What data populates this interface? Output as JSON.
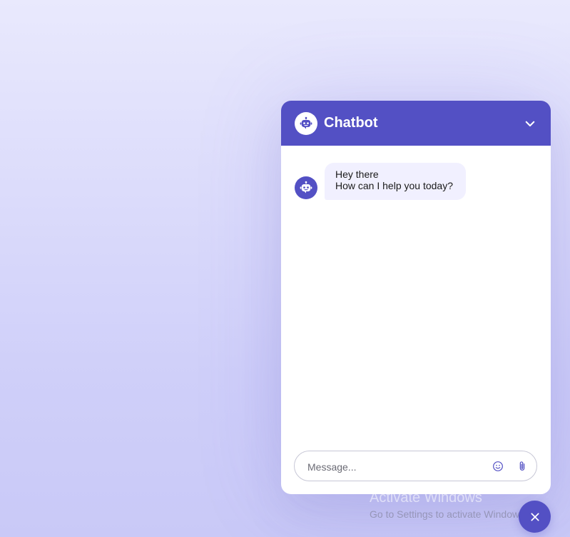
{
  "colors": {
    "primary": "#5350c4",
    "bubble_bg": "#f1f0ff",
    "background_top": "#e9e9fd",
    "background_bottom": "#c9c9f7"
  },
  "header": {
    "title": "Chatbot",
    "avatar_icon": "robot-icon",
    "collapse_icon": "chevron-down-icon"
  },
  "messages": [
    {
      "sender": "bot",
      "avatar_icon": "robot-icon",
      "lines": [
        "Hey there",
        "How can I help you today?"
      ]
    }
  ],
  "composer": {
    "placeholder": "Message...",
    "value": "",
    "emoji_icon": "smiley-icon",
    "attach_icon": "paperclip-icon"
  },
  "watermark": {
    "title": "Activate Windows",
    "subtitle": "Go to Settings to activate Windows."
  },
  "toggler": {
    "icon": "close-icon"
  }
}
